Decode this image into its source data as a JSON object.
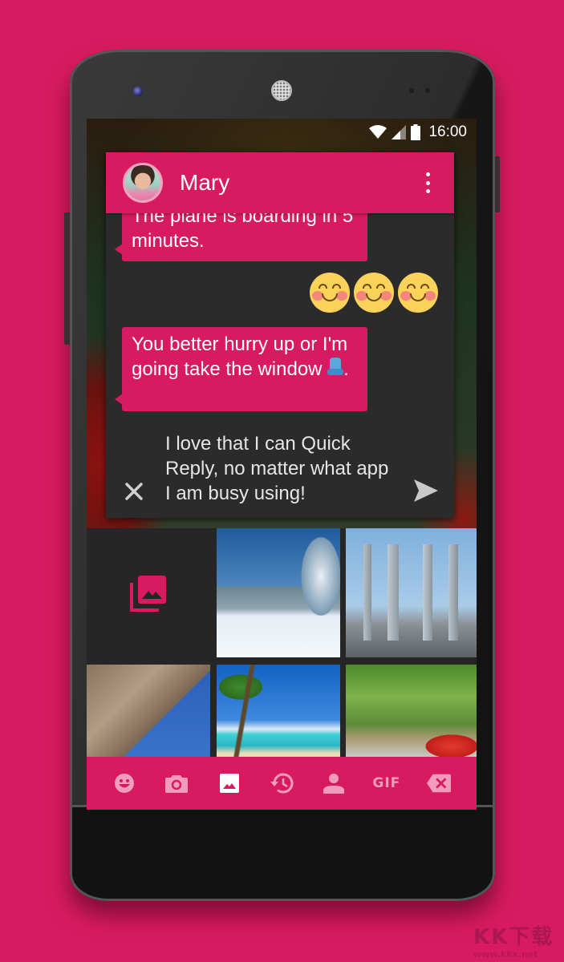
{
  "status_bar": {
    "time": "16:00",
    "icons": [
      "wifi-icon",
      "cell-signal-icon",
      "battery-icon"
    ]
  },
  "popup": {
    "contact_name": "Mary",
    "avatar": "contact-photo",
    "menu_icon": "more-vertical-icon",
    "messages": [
      {
        "direction": "incoming",
        "text": "The plane is boarding in 5 minutes."
      },
      {
        "direction": "outgoing",
        "text": "😊😊😊",
        "emoji": [
          "smiling-face-with-blush",
          "smiling-face-with-blush",
          "smiling-face-with-blush"
        ]
      },
      {
        "direction": "incoming",
        "text": "You better hurry up or I'm going take the window",
        "suffix": ".",
        "emoji": "seat"
      }
    ],
    "reply": {
      "value": "I love that I can Quick Reply, no matter what app I am busy using!",
      "close_icon": "close-icon",
      "send_icon": "send-icon"
    }
  },
  "gallery": {
    "open_icon": "photo-library-icon",
    "photos": [
      {
        "subject": "snowy forest"
      },
      {
        "subject": "industrial refinery"
      },
      {
        "subject": "stone house"
      },
      {
        "subject": "tropical beach with palm tree"
      },
      {
        "subject": "tree-lined road with red car"
      }
    ]
  },
  "toolbar": {
    "items": [
      {
        "name": "emoji",
        "icon": "emoji-icon",
        "active": false
      },
      {
        "name": "camera",
        "icon": "camera-icon",
        "active": false
      },
      {
        "name": "gallery",
        "icon": "image-icon",
        "active": true
      },
      {
        "name": "recent",
        "icon": "history-icon",
        "active": false
      },
      {
        "name": "contact",
        "icon": "person-icon",
        "active": false
      },
      {
        "name": "gif",
        "label": "GIF",
        "active": false
      },
      {
        "name": "backspace",
        "icon": "backspace-icon",
        "active": false
      }
    ]
  },
  "colors": {
    "accent": "#d81b60",
    "popup_bg": "#2b2b2b",
    "icon_inactive": "#f29cbc",
    "icon_active": "#ffffff"
  },
  "watermark": {
    "text": "KK下载",
    "url": "www.kkx.net"
  }
}
